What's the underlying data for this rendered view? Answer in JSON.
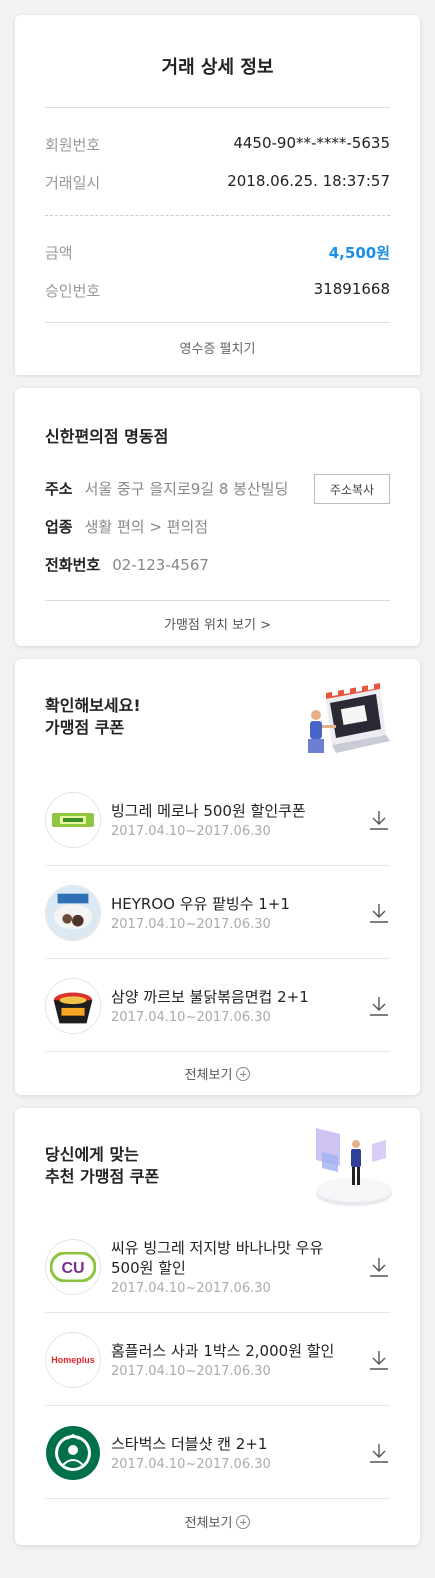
{
  "detail": {
    "title": "거래 상세 정보",
    "member_label": "회원번호",
    "member_value": "4450-90**-****-5635",
    "datetime_label": "거래일시",
    "datetime_value": "2018.06.25.  18:37:57",
    "amount_label": "금액",
    "amount_value": "4,500원",
    "approval_label": "승인번호",
    "approval_value": "31891668",
    "receipt_toggle": "영수증 펼치기",
    "accent_color": "#1a8fe3"
  },
  "store": {
    "name": "신한편의점 명동점",
    "address_label": "주소",
    "address_value": "서울 중구 을지로9길 8 봉산빌딩",
    "copy_button": "주소복사",
    "category_label": "업종",
    "category_value": "생활 편의 > 편의점",
    "phone_label": "전화번호",
    "phone_value": "02-123-4567",
    "location_link": "가맹점 위치 보기 >"
  },
  "coupons": {
    "heading_line1": "확인해보세요!",
    "heading_line2": "가맹점 쿠폰",
    "items": [
      {
        "title": "빙그레 메로나 500원 할인쿠폰",
        "date": "2017.04.10~2017.06.30",
        "icon": "melona-icon"
      },
      {
        "title": "HEYROO 우유 팥빙수 1+1",
        "date": "2017.04.10~2017.06.30",
        "icon": "bingsu-icon"
      },
      {
        "title": "삼양 까르보 불닭볶음면컵 2+1",
        "date": "2017.04.10~2017.06.30",
        "icon": "noodle-cup-icon"
      }
    ],
    "view_all": "전체보기"
  },
  "reco": {
    "heading_line1": "당신에게 맞는",
    "heading_line2": "추천 가맹점 쿠폰",
    "items": [
      {
        "title_line1": "씨유 빙그레 저지방 바나나맛 우유",
        "title_line2": "500원 할인",
        "date": "2017.04.10~2017.06.30",
        "icon": "cu-logo-icon",
        "logo_text": "CU"
      },
      {
        "title": "홈플러스 사과 1박스 2,000원 할인",
        "date": "2017.04.10~2017.06.30",
        "icon": "homeplus-logo-icon",
        "logo_text": "Homeplus"
      },
      {
        "title": "스타벅스 더블샷 캔 2+1",
        "date": "2017.04.10~2017.06.30",
        "icon": "starbucks-logo-icon"
      }
    ],
    "view_all": "전체보기"
  }
}
